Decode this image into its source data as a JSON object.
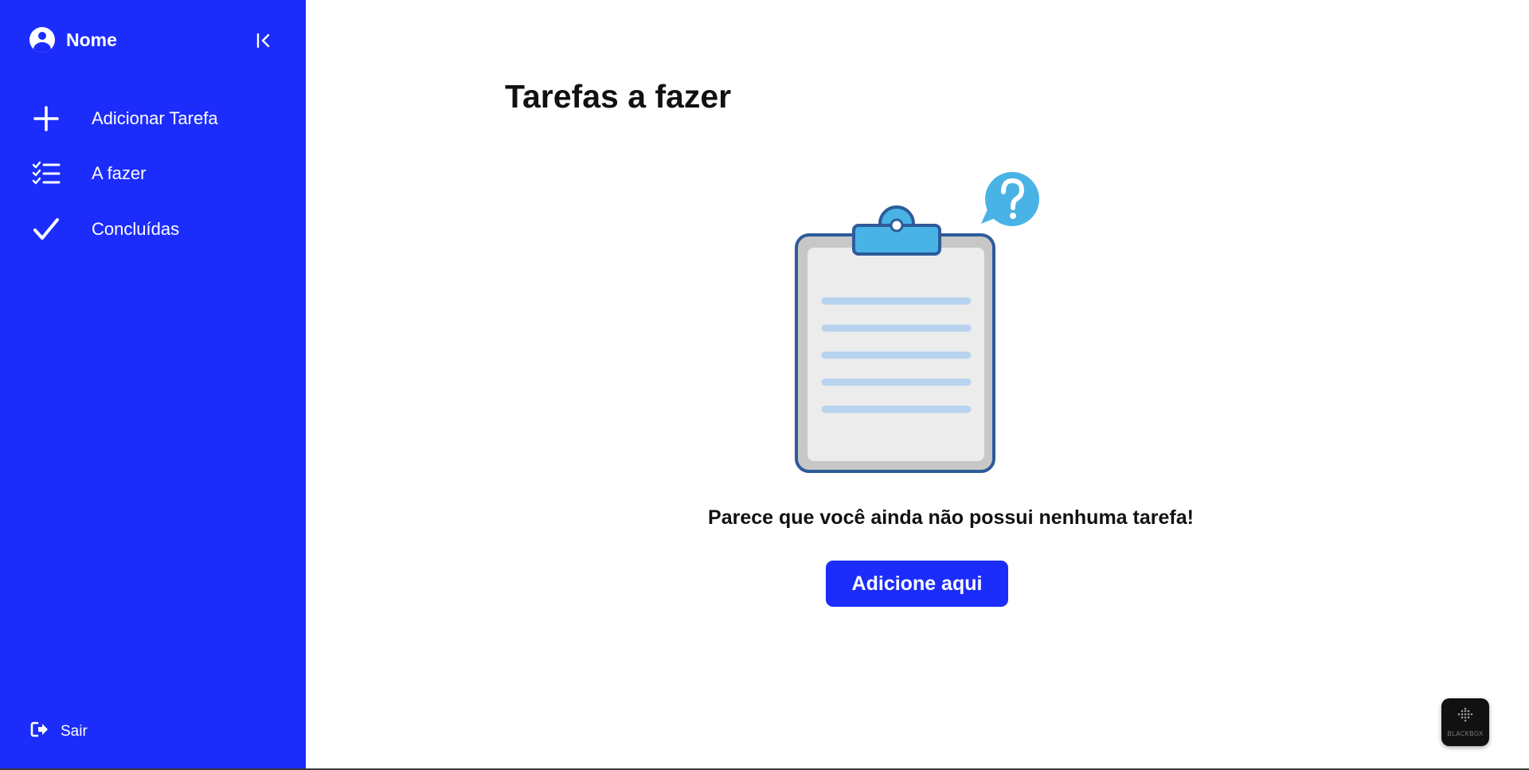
{
  "sidebar": {
    "profile_name": "Nome",
    "items": [
      {
        "label": "Adicionar Tarefa",
        "icon": "plus-icon"
      },
      {
        "label": "A fazer",
        "icon": "checklist-icon"
      },
      {
        "label": "Concluídas",
        "icon": "check-icon"
      }
    ],
    "logout_label": "Sair"
  },
  "main": {
    "title": "Tarefas a fazer",
    "empty_message": "Parece que você ainda não possui nenhuma tarefa!",
    "add_button_label": "Adicione aqui"
  },
  "widget": {
    "label": "BLACKBOX"
  },
  "colors": {
    "sidebar_bg": "#1c2dfb",
    "button_bg": "#1c2dfb",
    "text_dark": "#111111",
    "clipboard_clip": "#4ab3e6",
    "clipboard_outline": "#2d5b9a"
  }
}
